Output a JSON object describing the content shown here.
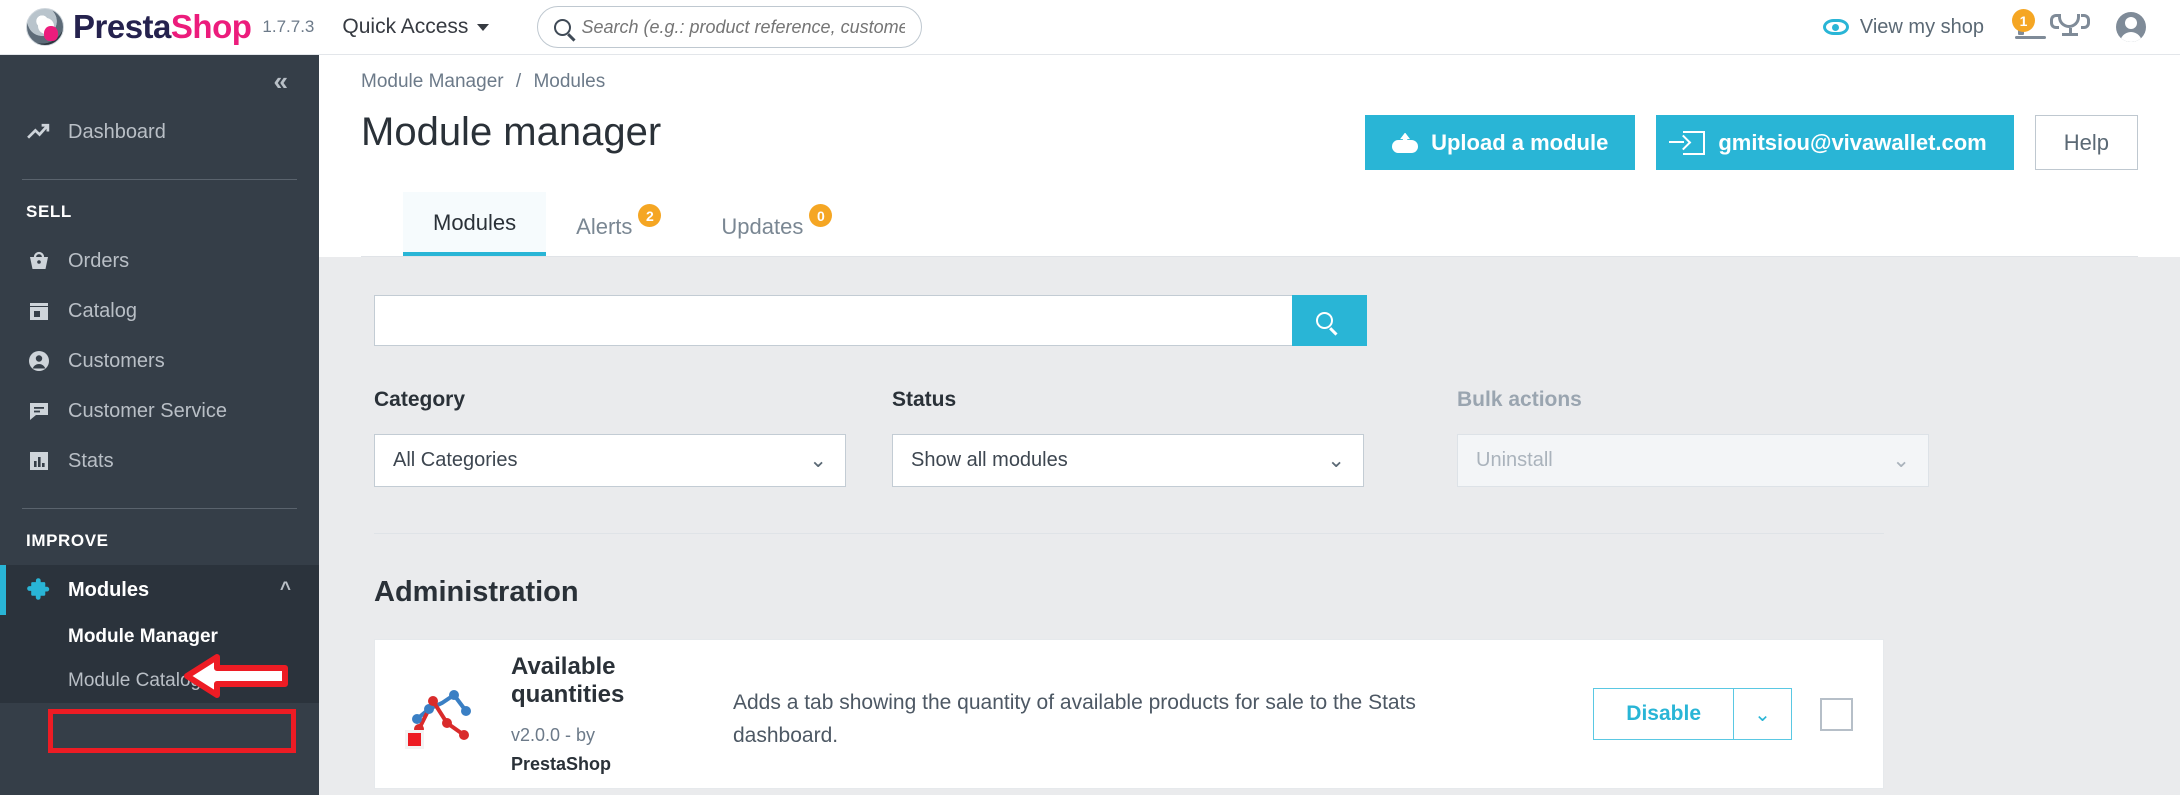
{
  "topbar": {
    "brand_presta": "Presta",
    "brand_shop": "Shop",
    "version": "1.7.7.3",
    "quick_access": "Quick Access",
    "search_placeholder": "Search (e.g.: product reference, custome",
    "search_value": "",
    "view_my_shop": "View my shop",
    "notifications_badge": "1"
  },
  "sidebar": {
    "dashboard": "Dashboard",
    "group_sell": "SELL",
    "sell_items": [
      "Orders",
      "Catalog",
      "Customers",
      "Customer Service",
      "Stats"
    ],
    "group_improve": "IMPROVE",
    "modules": "Modules",
    "submenu": [
      "Module Manager",
      "Module Catalog"
    ]
  },
  "header": {
    "breadcrumb_parent": "Module Manager",
    "breadcrumb_sep": "/",
    "breadcrumb_current": "Modules",
    "title": "Module manager",
    "upload_label": "Upload a module",
    "account_label": "gmitsiou@vivawallet.com",
    "help_label": "Help"
  },
  "tabs": [
    {
      "label": "Modules",
      "badge": null,
      "active": true
    },
    {
      "label": "Alerts",
      "badge": "2",
      "active": false
    },
    {
      "label": "Updates",
      "badge": "0",
      "active": false
    }
  ],
  "filters": {
    "search_value": "",
    "search_placeholder": "",
    "category_label": "Category",
    "category_value": "All Categories",
    "status_label": "Status",
    "status_value": "Show all modules",
    "bulk_label": "Bulk actions",
    "bulk_value": "Uninstall",
    "chevron": "⌄"
  },
  "section": {
    "title": "Administration"
  },
  "module": {
    "name": "Available quantities",
    "version": "v2.0.0 - by",
    "author": "PrestaShop",
    "description": "Adds a tab showing the quantity of available products for sale to the Stats dashboard.",
    "action_label": "Disable",
    "caret": "⌄"
  },
  "colors": {
    "accent": "#29b5d6",
    "brand_pink": "#ec1c7c",
    "sidebar": "#353e48",
    "badge": "#f5a623",
    "annotation_red": "#ed1c24"
  }
}
